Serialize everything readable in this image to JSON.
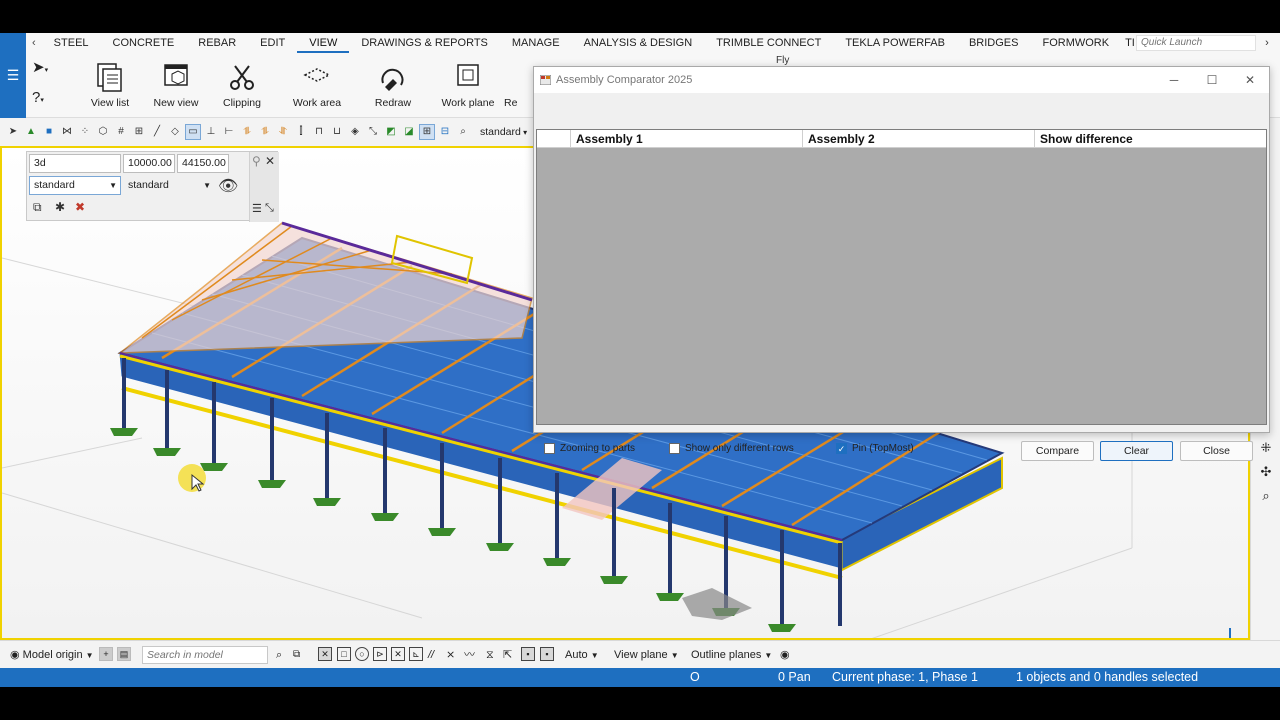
{
  "tabs": {
    "prev_icon": "‹",
    "items": [
      "STEEL",
      "CONCRETE",
      "REBAR",
      "EDIT",
      "VIEW",
      "DRAWINGS & REPORTS",
      "MANAGE",
      "ANALYSIS & DESIGN",
      "TRIMBLE CONNECT",
      "TEKLA POWERFAB",
      "BRIDGES",
      "FORMWORK",
      "TI"
    ],
    "active": "VIEW",
    "next_icon": "›",
    "quick_launch_placeholder": "Quick Launch"
  },
  "ribbon": {
    "view_list": "View list",
    "new_view": "New view",
    "clipping": "Clipping",
    "work_area": "Work area",
    "redraw": "Redraw",
    "work_plane": "Work plane",
    "partial": "Re",
    "fly": "Fly"
  },
  "toolbar": {
    "filter_value": "standard"
  },
  "view_panel": {
    "view_name": "3d",
    "depth_up": "10000.00",
    "depth_down": "44150.00",
    "view_filter": "standard",
    "display_setting": "standard"
  },
  "dialog": {
    "title": "Assembly Comparator 2025",
    "columns": [
      "Assembly 1",
      "Assembly 2",
      "Show difference"
    ],
    "zoom_to_parts_label": "Zooming to parts",
    "zoom_to_parts_checked": false,
    "only_different_label": "Show only different rows",
    "only_different_checked": false,
    "pin_label": "Pin (TopMost)",
    "pin_checked": true,
    "compare_label": "Compare",
    "clear_label": "Clear",
    "close_label": "Close"
  },
  "bottom_toolbar": {
    "model_origin": "Model origin",
    "search_placeholder": "Search in model",
    "auto": "Auto",
    "view_plane": "View plane",
    "outline_planes": "Outline planes"
  },
  "status": {
    "origin": "O",
    "pan": "0 Pan",
    "phase": "Current phase: 1, Phase 1",
    "selection": "1 objects and 0 handles selected"
  },
  "colors": {
    "accent": "#1e6fc0",
    "viewport_border": "#f0d200",
    "roof_blue": "#2a64b8",
    "steel_orange": "#e08a1e",
    "column_navy": "#24386e",
    "footing_green": "#3a8a2a"
  }
}
